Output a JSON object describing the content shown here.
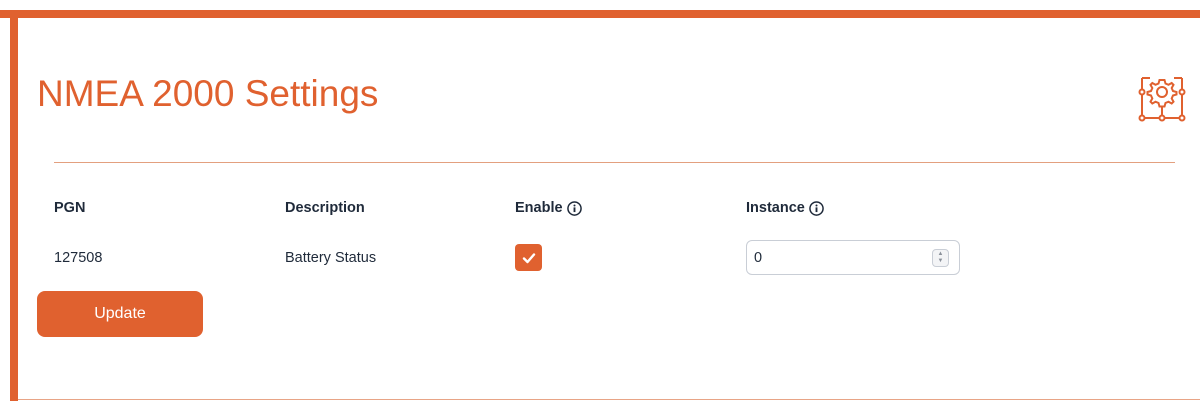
{
  "page": {
    "title": "NMEA 2000 Settings",
    "accent_color": "#e0612f",
    "header_icon": "gear-network-icon"
  },
  "table": {
    "headers": {
      "pgn": "PGN",
      "description": "Description",
      "enable": "Enable",
      "instance": "Instance"
    },
    "header_info_icon": "info-icon",
    "rows": [
      {
        "pgn": "127508",
        "description": "Battery Status",
        "enabled": true,
        "instance": "0"
      }
    ]
  },
  "actions": {
    "update_label": "Update"
  }
}
